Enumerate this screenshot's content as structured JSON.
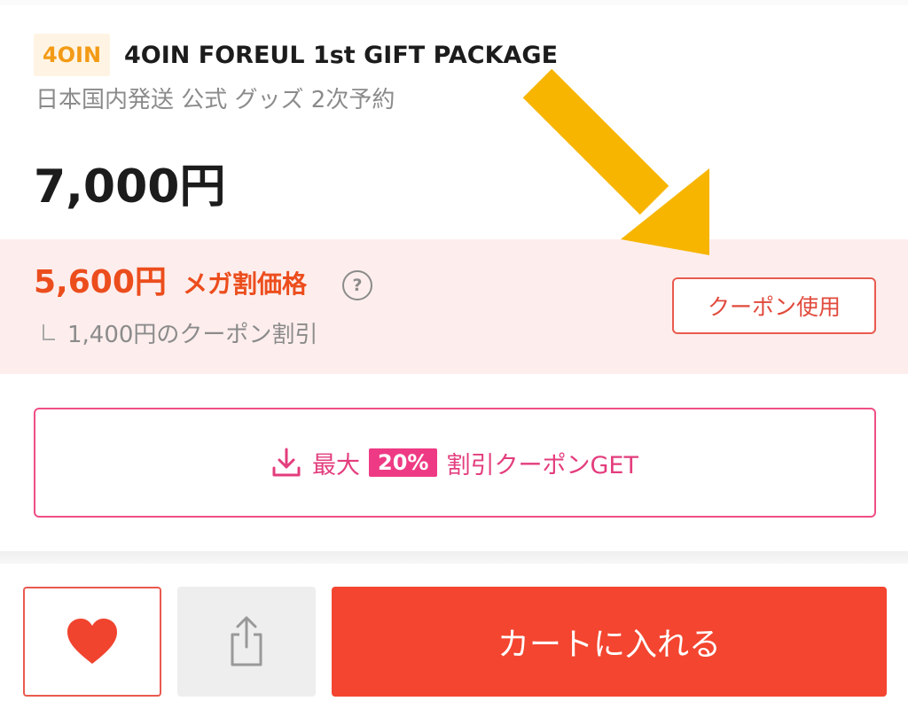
{
  "product": {
    "brand_badge": "4OIN",
    "title": "4OIN FOREUL 1st GIFT PACKAGE",
    "subtitle": "日本国内発送 公式 グッズ 2次予約",
    "price": "7,000円"
  },
  "coupon_panel": {
    "mega_price": "5,600円",
    "mega_label": "メガ割価格",
    "help_glyph": "?",
    "discount_note": "1,400円のクーポン割引",
    "use_coupon_label": "クーポン使用"
  },
  "get_coupon": {
    "prefix": "最大",
    "percent": "20%",
    "suffix": "割引クーポンGET"
  },
  "actions": {
    "wishlist_icon": "heart-icon",
    "share_icon": "share-icon",
    "add_to_cart_label": "カートに入れる"
  },
  "colors": {
    "accent_orange": "#ec4d1d",
    "coupon_pink": "#ee3a84",
    "cart_red": "#f3452f",
    "brand_orange": "#f39a16",
    "annotation_arrow": "#f7b500"
  }
}
